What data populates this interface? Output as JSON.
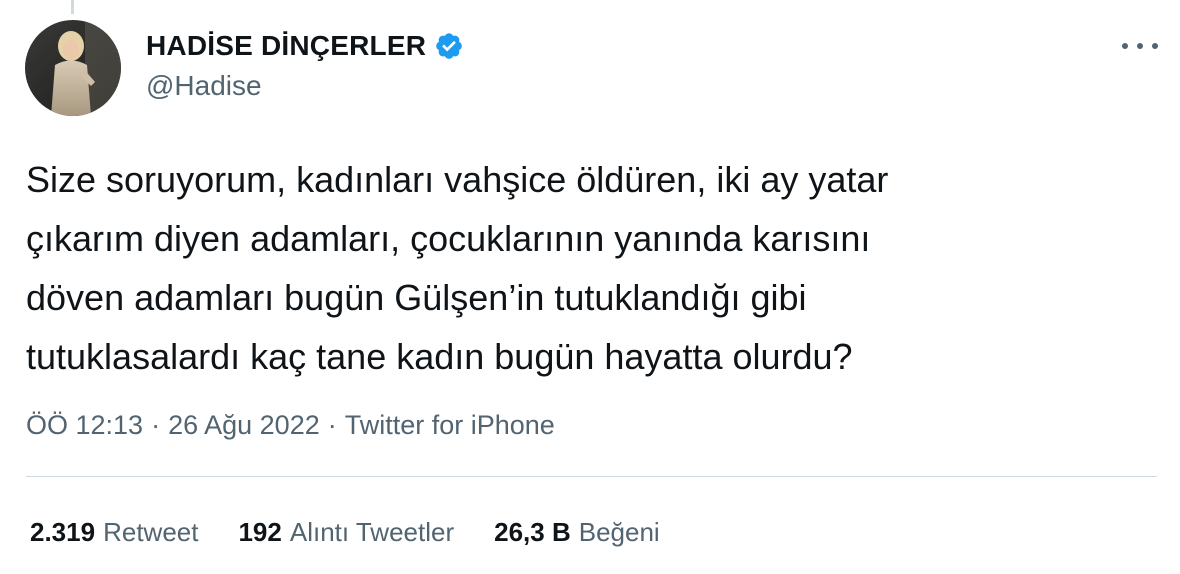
{
  "author": {
    "display_name": "HADİSE DİNÇERLER",
    "handle": "@Hadise",
    "verified": true,
    "avatar_icon": "profile-photo"
  },
  "tweet": {
    "text_lines": [
      "Size soruyorum, kadınları vahşice öldüren, iki ay yatar",
      "çıkarım diyen adamları, çocuklarının yanında karısını",
      "döven adamları bugün Gülşen’in tutuklandığı gibi",
      "tutuklasalardı kaç tane kadın bugün hayatta olurdu?"
    ],
    "time": "ÖÖ 12:13",
    "date": "26 Ağu 2022",
    "source": "Twitter for iPhone",
    "separator": "·"
  },
  "stats": {
    "retweets": {
      "count": "2.319",
      "label": "Retweet"
    },
    "quotes": {
      "count": "192",
      "label": "Alıntı Tweetler"
    },
    "likes": {
      "count": "26,3 B",
      "label": "Beğeni"
    }
  },
  "colors": {
    "text": "#0f1419",
    "secondary": "#536471",
    "verified_blue": "#1d9bf0",
    "divider": "#cfd9de"
  },
  "icons": {
    "more": "more-horizontal-icon",
    "verified": "verified-badge-icon"
  }
}
